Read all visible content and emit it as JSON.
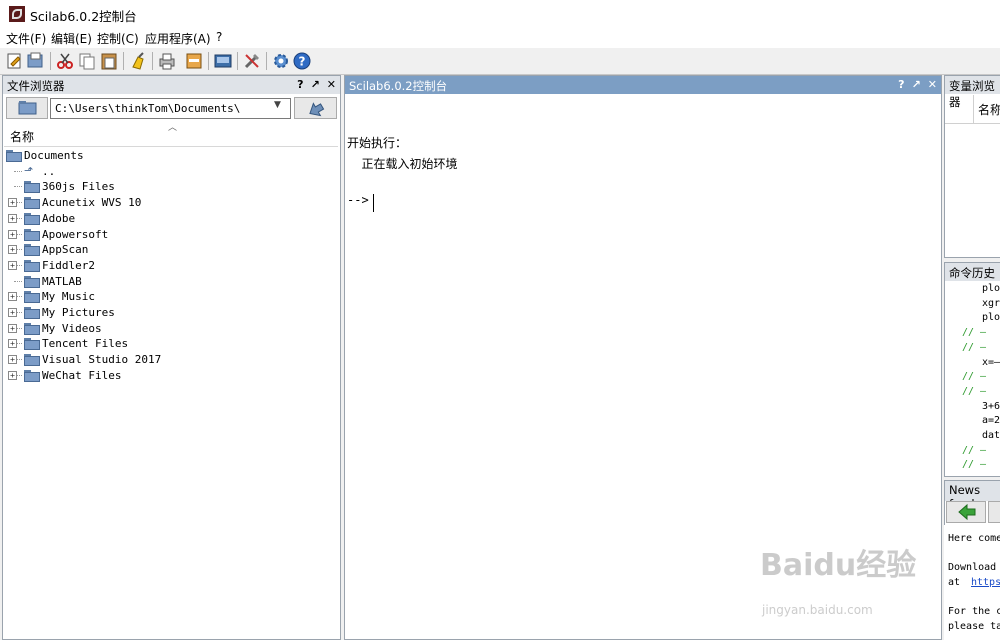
{
  "window": {
    "title": "Scilab6.0.2控制台"
  },
  "menu": [
    "文件(F)",
    "编辑(E)",
    "控制(C)",
    "应用程序(A)",
    "?"
  ],
  "toolbar": [
    "new-script-icon",
    "open-file-icon",
    "cut-icon",
    "copy-icon",
    "paste-icon",
    "clear-console-icon",
    "print-icon",
    "variable-browser-icon",
    "demo-icon",
    "module-manager-icon",
    "settings-icon",
    "help-icon"
  ],
  "file_browser": {
    "title": "文件浏览器",
    "head_buttons": [
      "?",
      "↗",
      "✕"
    ],
    "path": "C:\\Users\\thinkTom\\Documents\\",
    "column": "名称",
    "tree": [
      {
        "label": "Documents",
        "level": 0,
        "expandable": false,
        "folder": true
      },
      {
        "label": "..",
        "level": 1,
        "expandable": false,
        "folder": false
      },
      {
        "label": "360js Files",
        "level": 1,
        "expandable": false,
        "folder": true
      },
      {
        "label": "Acunetix WVS 10",
        "level": 1,
        "expandable": true,
        "folder": true
      },
      {
        "label": "Adobe",
        "level": 1,
        "expandable": true,
        "folder": true
      },
      {
        "label": "Apowersoft",
        "level": 1,
        "expandable": true,
        "folder": true
      },
      {
        "label": "AppScan",
        "level": 1,
        "expandable": true,
        "folder": true
      },
      {
        "label": "Fiddler2",
        "level": 1,
        "expandable": true,
        "folder": true
      },
      {
        "label": "MATLAB",
        "level": 1,
        "expandable": false,
        "folder": true
      },
      {
        "label": "My Music",
        "level": 1,
        "expandable": true,
        "folder": true
      },
      {
        "label": "My Pictures",
        "level": 1,
        "expandable": true,
        "folder": true
      },
      {
        "label": "My Videos",
        "level": 1,
        "expandable": true,
        "folder": true
      },
      {
        "label": "Tencent Files",
        "level": 1,
        "expandable": true,
        "folder": true
      },
      {
        "label": "Visual Studio 2017",
        "level": 1,
        "expandable": true,
        "folder": true
      },
      {
        "label": "WeChat Files",
        "level": 1,
        "expandable": true,
        "folder": true
      }
    ]
  },
  "console": {
    "title": "Scilab6.0.2控制台",
    "head_buttons": [
      "?",
      "↗",
      "✕"
    ],
    "lines": [
      "开始执行：",
      "  正在载入初始环境"
    ],
    "prompt": "-->"
  },
  "variable_browser": {
    "title": "变量浏览器",
    "column": "名称"
  },
  "command_history": {
    "title": "命令历史",
    "rows": [
      {
        "text": "plo",
        "green": false
      },
      {
        "text": "xgr",
        "green": false
      },
      {
        "text": "plo",
        "green": false
      },
      {
        "text": "// —",
        "green": true
      },
      {
        "text": "// —",
        "green": true
      },
      {
        "text": "x=—",
        "green": false
      },
      {
        "text": "// —",
        "green": true
      },
      {
        "text": "// —",
        "green": true
      },
      {
        "text": "3+6",
        "green": false
      },
      {
        "text": "a=2",
        "green": false
      },
      {
        "text": "dat",
        "green": false
      },
      {
        "text": "// —",
        "green": true
      },
      {
        "text": "// —",
        "green": true
      }
    ]
  },
  "news_feed": {
    "title": "News feed",
    "lines": [
      "Here come",
      "Download",
      "at",
      "https",
      "For the c",
      "please ta"
    ]
  },
  "watermark": {
    "main": "Baidu经验",
    "sub": "jingyan.baidu.com"
  }
}
